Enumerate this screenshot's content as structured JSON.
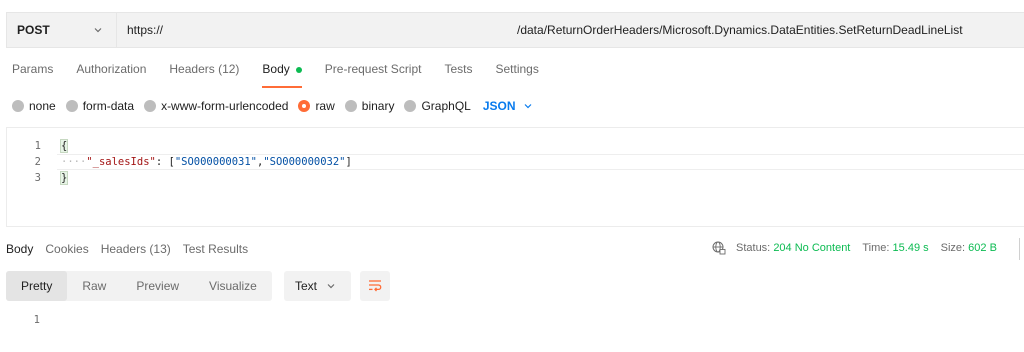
{
  "request": {
    "method": "POST",
    "url_prefix": "https://",
    "url_path": "/data/ReturnOrderHeaders/Microsoft.Dynamics.DataEntities.SetReturnDeadLineList"
  },
  "request_tabs": [
    {
      "label": "Params"
    },
    {
      "label": "Authorization"
    },
    {
      "label": "Headers (12)"
    },
    {
      "label": "Body"
    },
    {
      "label": "Pre-request Script"
    },
    {
      "label": "Tests"
    },
    {
      "label": "Settings"
    }
  ],
  "body_types": [
    {
      "label": "none"
    },
    {
      "label": "form-data"
    },
    {
      "label": "x-www-form-urlencoded"
    },
    {
      "label": "raw"
    },
    {
      "label": "binary"
    },
    {
      "label": "GraphQL"
    }
  ],
  "body_language": "JSON",
  "editor": {
    "line_numbers": [
      "1",
      "2",
      "3"
    ],
    "open_brace": "{",
    "indent_dots": "····",
    "key": "\"_salesIds\"",
    "colon": ": [",
    "value1": "\"SO000000031\"",
    "comma": ",",
    "value2": "\"SO000000032\"",
    "close_bracket": "]",
    "close_brace": "}"
  },
  "response_tabs": [
    {
      "label": "Body"
    },
    {
      "label": "Cookies"
    },
    {
      "label": "Headers (13)"
    },
    {
      "label": "Test Results"
    }
  ],
  "status": {
    "status_label": "Status:",
    "status_value": "204 No Content",
    "time_label": "Time:",
    "time_value": "15.49 s",
    "size_label": "Size:",
    "size_value": "602 B"
  },
  "view_modes": [
    {
      "label": "Pretty"
    },
    {
      "label": "Raw"
    },
    {
      "label": "Preview"
    },
    {
      "label": "Visualize"
    }
  ],
  "format_select": "Text",
  "response_line_numbers": [
    "1"
  ],
  "colors": {
    "accent_orange": "#ff6c37",
    "success_green": "#0cbb52",
    "link_blue": "#097bed"
  }
}
